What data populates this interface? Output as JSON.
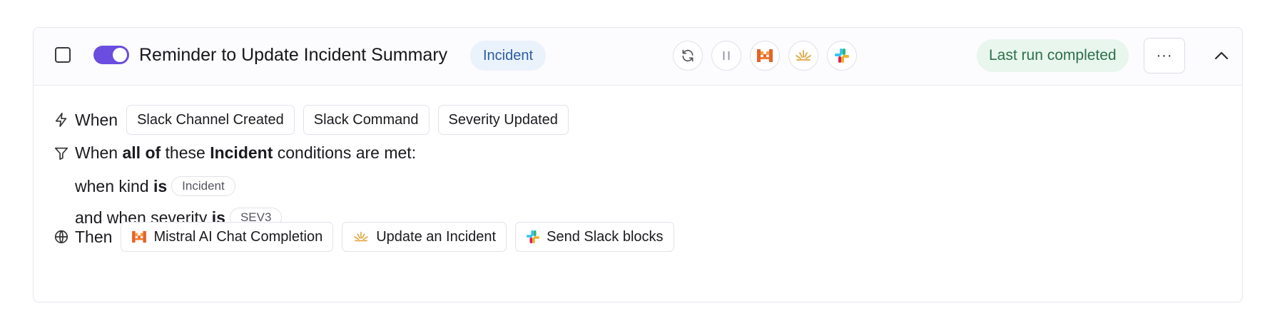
{
  "automation": {
    "title": "Reminder to Update Incident Summary",
    "tag": "Incident",
    "status": "Last run completed",
    "more_label": "···"
  },
  "colors": {
    "toggle_on": "#6b4de0",
    "tag_bg": "#eaf2fc",
    "status_bg": "#e8f6ee",
    "mistral_orange": "#e8622a",
    "incident_gold": "#e0a53c"
  },
  "when": {
    "label": "When",
    "triggers": [
      "Slack Channel Created",
      "Slack Command",
      "Severity Updated"
    ]
  },
  "conditions": {
    "intro_pre": "When",
    "intro_bold1": "all of",
    "intro_mid": "these",
    "intro_bold2": "Incident",
    "intro_post": "conditions are met:",
    "items": [
      {
        "prefix": "when kind",
        "op": "is",
        "value": "Incident"
      },
      {
        "prefix": "and when severity",
        "op": "is",
        "value": "SEV3"
      }
    ]
  },
  "then": {
    "label": "Then",
    "actions": [
      {
        "label": "Mistral AI Chat Completion",
        "icon": "mistral-icon"
      },
      {
        "label": "Update an Incident",
        "icon": "incident-lotus-icon"
      },
      {
        "label": "Send Slack blocks",
        "icon": "slack-icon"
      }
    ]
  }
}
